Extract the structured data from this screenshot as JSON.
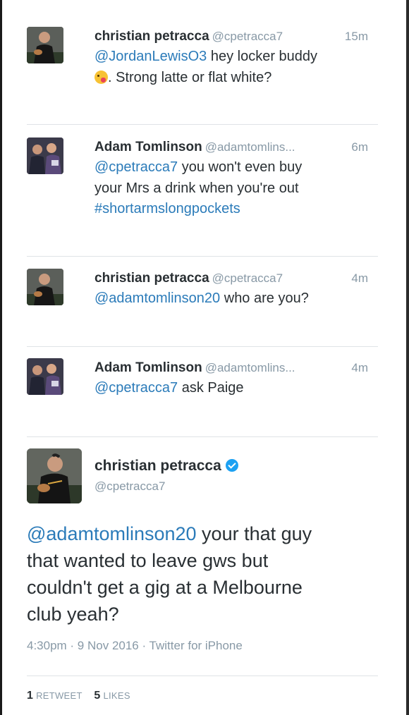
{
  "tweets": [
    {
      "name": "christian petracca",
      "handle": "@cpetracca7",
      "time": "15m",
      "mention": "@JordanLewisO3",
      "text1": " hey locker buddy",
      "emoji": "winking-face-with-tongue",
      "text2": ". Strong latte or flat white?"
    },
    {
      "name": "Adam Tomlinson",
      "handle": "@adamtomlins...",
      "time": "6m",
      "mention": "@cpetracca7",
      "text1": " you won't even buy",
      "text2": "your Mrs a drink when you're out",
      "hashtag": "#shortarmslongpockets"
    },
    {
      "name": "christian petracca",
      "handle": "@cpetracca7",
      "time": "4m",
      "mention": "@adamtomlinson20",
      "text1": " who are you?"
    },
    {
      "name": "Adam Tomlinson",
      "handle": "@adamtomlins...",
      "time": "4m",
      "mention": "@cpetracca7",
      "text1": " ask Paige"
    }
  ],
  "main": {
    "name": "christian petracca",
    "verified": true,
    "handle": "@cpetracca7",
    "mention": "@adamtomlinson20",
    "text1": " your that guy",
    "text2": "that wanted to leave gws but",
    "text3": "couldn't get a gig at a Melbourne",
    "text4": "club yeah?",
    "meta": "4:30pm · 9 Nov 2016 · Twitter for iPhone",
    "retweets_count": "1",
    "retweets_label": "RETWEET",
    "likes_count": "5",
    "likes_label": "LIKES"
  }
}
